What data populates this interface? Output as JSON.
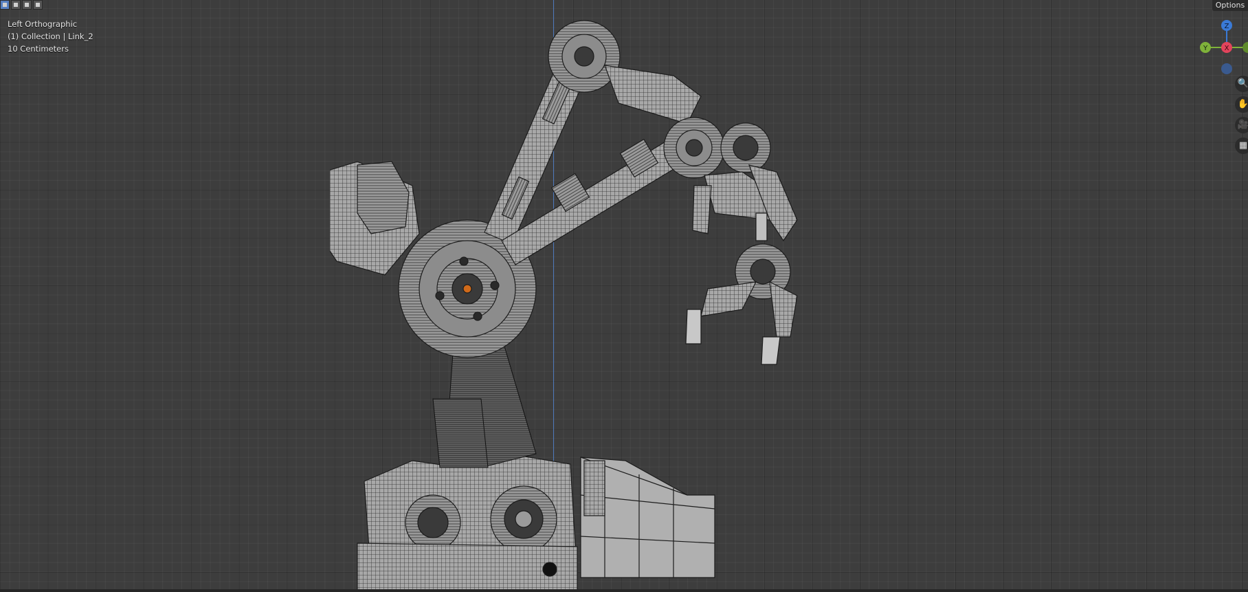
{
  "viewport": {
    "view_name": "Left Orthographic",
    "collection": "(1) Collection | Link_2",
    "scale": "10 Centimeters"
  },
  "header": {
    "options_label": "Options",
    "select_modes": [
      "select-box-icon",
      "select-extend-icon",
      "select-subtract-icon",
      "select-intersect-icon"
    ]
  },
  "gizmo": {
    "z_label": "Z",
    "y_label": "Y",
    "x_label": "X",
    "colors": {
      "x": "#e2445c",
      "y": "#7fb23a",
      "z": "#3a7ad6",
      "neg": "#3a5a8f"
    }
  },
  "nav_tools": [
    {
      "name": "zoom-icon",
      "glyph": "🔍"
    },
    {
      "name": "pan-hand-icon",
      "glyph": "✋"
    },
    {
      "name": "camera-icon",
      "glyph": "🎥"
    },
    {
      "name": "grid-icon",
      "glyph": "▦"
    }
  ],
  "colors": {
    "background": "#3d3d3d",
    "mesh_fill": "#a8a8a8",
    "mesh_wire": "#1c1c1c",
    "z_axis": "#4f7fc9"
  }
}
